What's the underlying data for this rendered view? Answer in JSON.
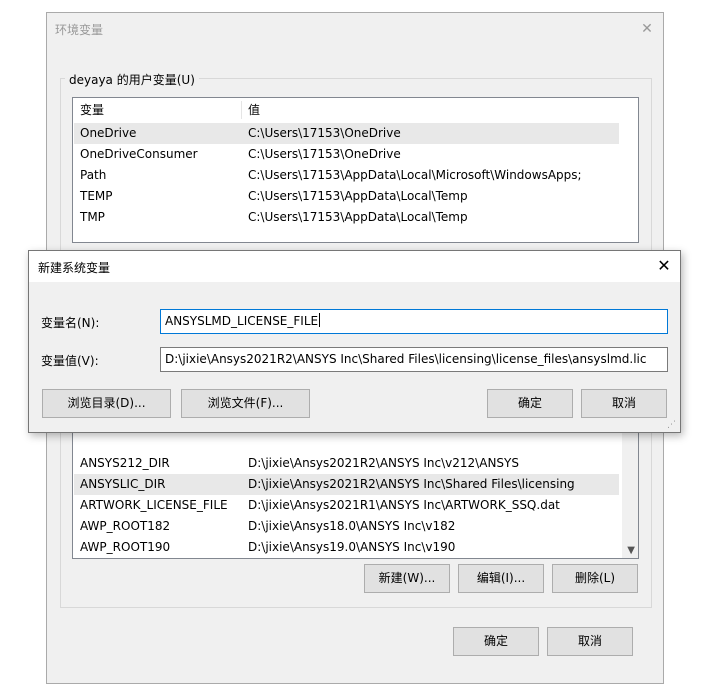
{
  "env_window": {
    "title": "环境变量",
    "close_glyph": "✕",
    "user_group_label": "deyaya 的用户变量(U)",
    "user_vars": {
      "columns": [
        "变量",
        "值"
      ],
      "rows": [
        {
          "name": "OneDrive",
          "value": "C:\\Users\\17153\\OneDrive"
        },
        {
          "name": "OneDriveConsumer",
          "value": "C:\\Users\\17153\\OneDrive"
        },
        {
          "name": "Path",
          "value": "C:\\Users\\17153\\AppData\\Local\\Microsoft\\WindowsApps;"
        },
        {
          "name": "TEMP",
          "value": "C:\\Users\\17153\\AppData\\Local\\Temp"
        },
        {
          "name": "TMP",
          "value": "C:\\Users\\17153\\AppData\\Local\\Temp"
        }
      ]
    },
    "system_vars": {
      "rows": [
        {
          "name": "ANSYS212_DIR",
          "value": "D:\\jixie\\Ansys2021R2\\ANSYS Inc\\v212\\ANSYS"
        },
        {
          "name": "ANSYSLIC_DIR",
          "value": "D:\\jixie\\Ansys2021R2\\ANSYS Inc\\Shared Files\\licensing"
        },
        {
          "name": "ARTWORK_LICENSE_FILE",
          "value": "D:\\jixie\\Ansys2021R1\\ANSYS Inc\\ARTWORK_SSQ.dat"
        },
        {
          "name": "AWP_ROOT182",
          "value": "D:\\jixie\\Ansys18.0\\ANSYS Inc\\v182"
        },
        {
          "name": "AWP_ROOT190",
          "value": "D:\\jixie\\Ansys19.0\\ANSYS Inc\\v190"
        }
      ],
      "buttons": {
        "new": "新建(W)...",
        "edit": "编辑(I)...",
        "delete": "删除(L)"
      }
    },
    "ok": "确定",
    "cancel": "取消"
  },
  "new_var_dialog": {
    "title": "新建系统变量",
    "close_glyph": "✕",
    "name_label": "变量名(N):",
    "name_value": "ANSYSLMD_LICENSE_FILE",
    "value_label": "变量值(V):",
    "value_value": "D:\\jixie\\Ansys2021R2\\ANSYS Inc\\Shared Files\\licensing\\license_files\\ansyslmd.lic",
    "browse_dir": "浏览目录(D)...",
    "browse_file": "浏览文件(F)...",
    "ok": "确定",
    "cancel": "取消"
  }
}
